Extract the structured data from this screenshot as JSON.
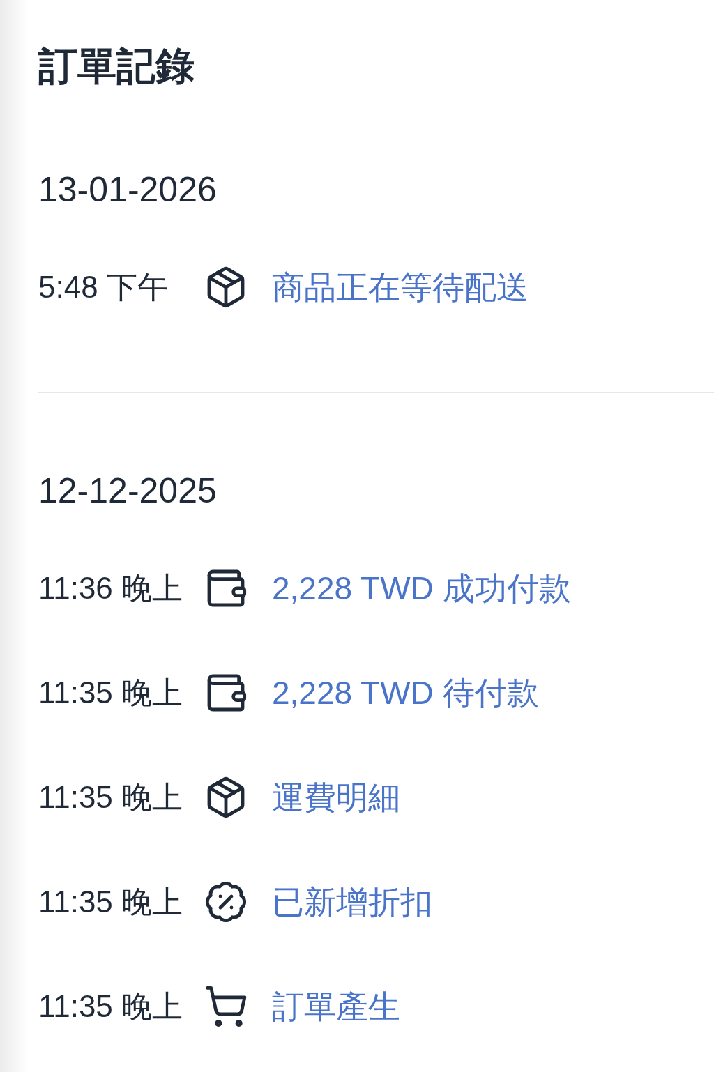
{
  "title": "訂單記錄",
  "sections": [
    {
      "date": "13-01-2026",
      "entries": [
        {
          "time": "5:48 下午",
          "kind": "package",
          "text": "商品正在等待配送"
        }
      ]
    },
    {
      "date": "12-12-2025",
      "entries": [
        {
          "time": "11:36 晚上",
          "kind": "wallet",
          "text": "2,228 TWD 成功付款"
        },
        {
          "time": "11:35 晚上",
          "kind": "wallet",
          "text": "2,228 TWD 待付款"
        },
        {
          "time": "11:35 晚上",
          "kind": "package",
          "text": "運費明細"
        },
        {
          "time": "11:35 晚上",
          "kind": "discount",
          "text": "已新增折扣"
        },
        {
          "time": "11:35 晚上",
          "kind": "cart",
          "text": "訂單產生"
        }
      ]
    }
  ]
}
